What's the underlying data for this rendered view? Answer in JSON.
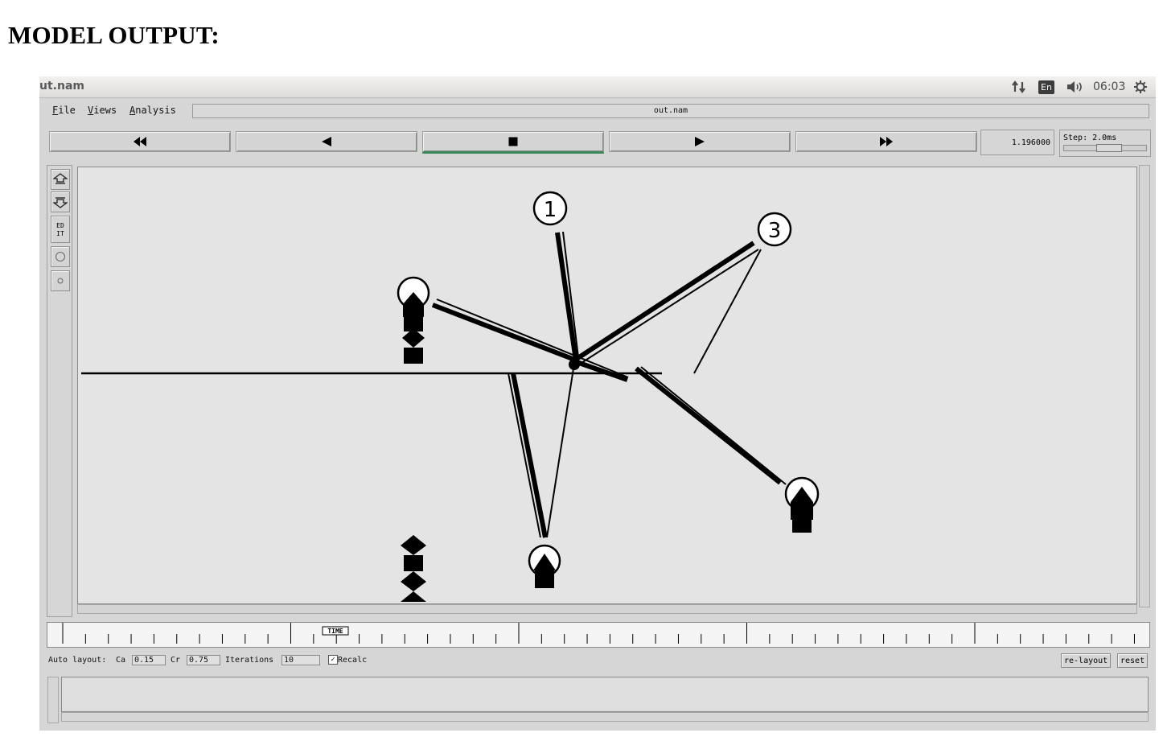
{
  "heading": "MODEL OUTPUT:",
  "window": {
    "title": "ut.nam",
    "clock": "06:03",
    "language": "En"
  },
  "menu": {
    "file": "File",
    "views": "Views",
    "analysis": "Analysis",
    "filename": "out.nam"
  },
  "controls": {
    "current_time": "1.196000",
    "step": "Step: 2.0ms"
  },
  "nodes": [
    {
      "label": "1"
    },
    {
      "label": "3"
    }
  ],
  "timeline": {
    "marker": "TIME"
  },
  "auto_layout": {
    "label": "Auto layout:",
    "ca_label": "Ca",
    "ca_value": "0.15",
    "cr_label": "Cr",
    "cr_value": "0.75",
    "iterations_label": "Iterations",
    "iterations_value": "10",
    "recalc_label": "Recalc",
    "recalc_checked": true,
    "relayout_button": "re-layout",
    "reset_button": "reset"
  }
}
